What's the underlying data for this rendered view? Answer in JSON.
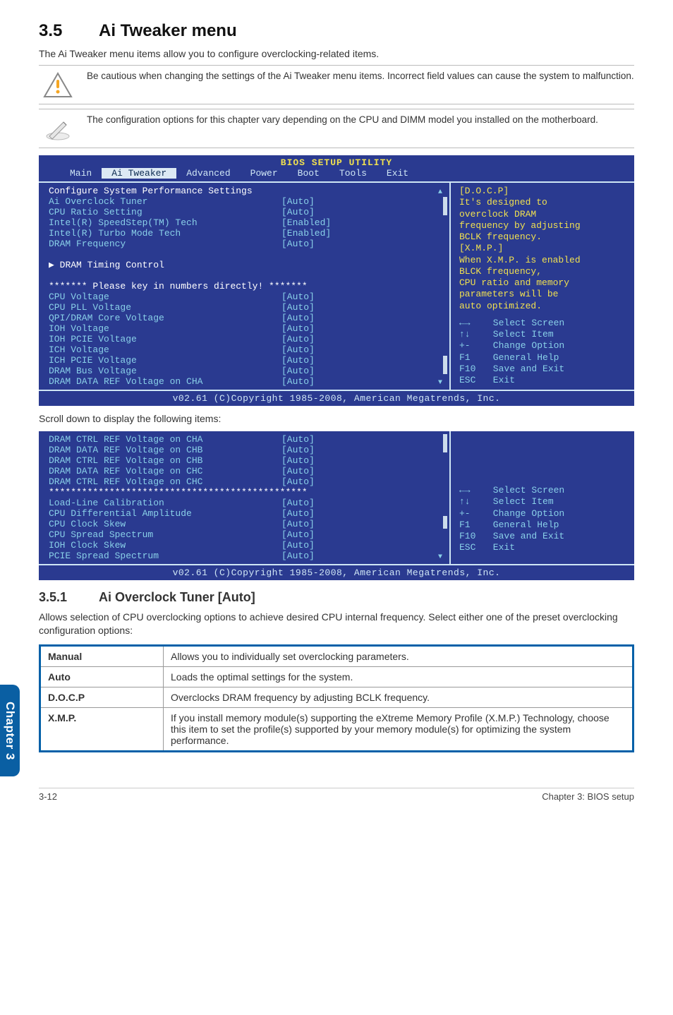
{
  "page": {
    "section_num": "3.5",
    "section_title": "Ai Tweaker menu",
    "lead": "The Ai Tweaker menu items allow you to configure overclocking-related items.",
    "note1": "Be cautious when changing the settings of the Ai Tweaker menu items. Incorrect field values can cause the system to malfunction.",
    "note2": "The configuration options for this chapter vary depending on the CPU and DIMM model you installed on the motherboard.",
    "scroll_note": "Scroll down to display the following items:",
    "sub_num": "3.5.1",
    "sub_title": "Ai Overclock Tuner [Auto]",
    "sub_desc": "Allows selection of CPU overclocking options to achieve desired CPU internal frequency. Select either one of the preset overclocking configuration options:",
    "chapter_tab": "Chapter 3",
    "footer_left": "3-12",
    "footer_right": "Chapter 3: BIOS setup"
  },
  "bios": {
    "title": "BIOS SETUP UTILITY",
    "tabs": [
      "Main",
      "Ai Tweaker",
      "Advanced",
      "Power",
      "Boot",
      "Tools",
      "Exit"
    ],
    "active_tab": "Ai Tweaker",
    "header": "Configure System Performance Settings",
    "left1": [
      {
        "lab": "Ai Overclock Tuner",
        "val": "[Auto]"
      },
      {
        "lab": "CPU Ratio Setting",
        "val": "[Auto]"
      },
      {
        "lab": "Intel(R) SpeedStep(TM) Tech",
        "val": "[Enabled]"
      },
      {
        "lab": "Intel(R) Turbo Mode Tech",
        "val": "[Enabled]"
      },
      {
        "lab": "DRAM Frequency",
        "val": "[Auto]"
      }
    ],
    "dram_timing": "DRAM Timing Control",
    "please_key": "******* Please key in numbers directly! *******",
    "left2": [
      {
        "lab": "CPU Voltage",
        "val": "[Auto]"
      },
      {
        "lab": "CPU PLL Voltage",
        "val": "[Auto]"
      },
      {
        "lab": "QPI/DRAM Core Voltage",
        "val": "[Auto]"
      },
      {
        "lab": "IOH Voltage",
        "val": "[Auto]"
      },
      {
        "lab": "IOH PCIE Voltage",
        "val": "[Auto]"
      },
      {
        "lab": "ICH Voltage",
        "val": "[Auto]"
      },
      {
        "lab": "ICH PCIE Voltage",
        "val": "[Auto]"
      },
      {
        "lab": "DRAM Bus Voltage",
        "val": "[Auto]"
      },
      {
        "lab": "DRAM DATA REF Voltage on CHA",
        "val": "[Auto]"
      }
    ],
    "right_help": "[D.O.C.P]\nIt's designed to\noverclock DRAM\nfrequency by adjusting\nBCLK frequency.\n[X.M.P.]\nWhen X.M.P. is enabled\nBLCK frequency,\nCPU ratio and memory\nparameters will be\nauto optimized.",
    "nav": [
      {
        "k": "←→",
        "t": "Select Screen"
      },
      {
        "k": "↑↓",
        "t": "Select Item"
      },
      {
        "k": "+-",
        "t": "Change Option"
      },
      {
        "k": "F1",
        "t": "General Help"
      },
      {
        "k": "F10",
        "t": "Save and Exit"
      },
      {
        "k": "ESC",
        "t": "Exit"
      }
    ],
    "footer": "v02.61 (C)Copyright 1985-2008, American Megatrends, Inc."
  },
  "bios2": {
    "left": [
      {
        "lab": "DRAM CTRL REF Voltage on CHA",
        "val": "[Auto]"
      },
      {
        "lab": "DRAM DATA REF Voltage on CHB",
        "val": "[Auto]"
      },
      {
        "lab": "DRAM CTRL REF Voltage on CHB",
        "val": "[Auto]"
      },
      {
        "lab": "DRAM DATA REF Voltage on CHC",
        "val": "[Auto]"
      },
      {
        "lab": "DRAM CTRL REF Voltage on CHC",
        "val": "[Auto]"
      }
    ],
    "stars": "***********************************************",
    "left2": [
      {
        "lab": "Load-Line Calibration",
        "val": "[Auto]"
      },
      {
        "lab": "CPU Differential Amplitude",
        "val": "[Auto]"
      },
      {
        "lab": "CPU Clock Skew",
        "val": "[Auto]"
      },
      {
        "lab": "CPU Spread Spectrum",
        "val": "[Auto]"
      },
      {
        "lab": "IOH Clock Skew",
        "val": "[Auto]"
      },
      {
        "lab": "PCIE Spread Spectrum",
        "val": "[Auto]"
      }
    ]
  },
  "opts": [
    {
      "k": "Manual",
      "v": "Allows you to individually set overclocking parameters."
    },
    {
      "k": "Auto",
      "v": "Loads the optimal settings for the system."
    },
    {
      "k": "D.O.C.P",
      "v": "Overclocks DRAM frequency by adjusting BCLK frequency."
    },
    {
      "k": "X.M.P.",
      "v": "If you install memory module(s) supporting the eXtreme Memory Profile (X.M.P.) Technology, choose this item to set the profile(s) supported by your memory module(s) for optimizing the system performance."
    }
  ]
}
